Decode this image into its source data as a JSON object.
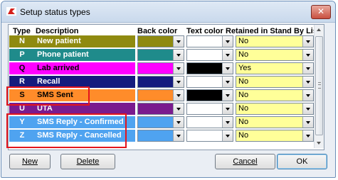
{
  "window": {
    "title": "Setup status types"
  },
  "columns": {
    "type": "Type",
    "description": "Description",
    "back_color": "Back color",
    "text_color": "Text color",
    "retained": "Retained in Stand By List"
  },
  "rows": [
    {
      "code": "N",
      "description": "New patient",
      "back_color": "#8f8a10",
      "text_color": "#ffffff",
      "retained": "No"
    },
    {
      "code": "P",
      "description": "Phone patient",
      "back_color": "#1f8b8b",
      "text_color": "#ffffff",
      "retained": "No"
    },
    {
      "code": "Q",
      "description": "Lab arrived",
      "back_color": "#ff00ff",
      "text_color": "#000000",
      "retained": "Yes"
    },
    {
      "code": "R",
      "description": "Recall",
      "back_color": "#151b7e",
      "text_color": "#ffffff",
      "retained": "No"
    },
    {
      "code": "S",
      "description": "SMS Sent",
      "back_color": "#ff8c2a",
      "text_color": "#000000",
      "retained": "No"
    },
    {
      "code": "U",
      "description": "UTA",
      "back_color": "#7a1b8e",
      "text_color": "#ffffff",
      "retained": "No"
    },
    {
      "code": "Y",
      "description": "SMS Reply - Confirmed",
      "back_color": "#4fa3f0",
      "text_color": "#ffffff",
      "retained": "No"
    },
    {
      "code": "Z",
      "description": "SMS Reply - Cancelled",
      "back_color": "#4fa3f0",
      "text_color": "#ffffff",
      "retained": "No"
    }
  ],
  "buttons": {
    "new": "New",
    "delete": "Delete",
    "cancel": "Cancel",
    "ok": "OK"
  },
  "colors": {
    "highlight": "#e3141c",
    "retained_field": "#ffff99"
  }
}
